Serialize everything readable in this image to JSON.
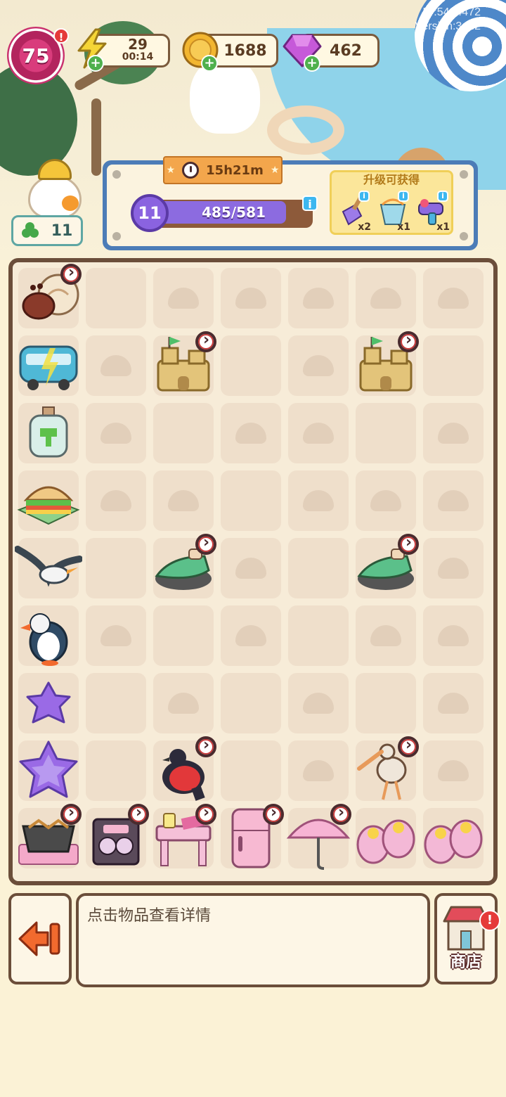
{
  "debug": {
    "id_text": "ID:5484472",
    "version_text": "Version:3.0.2"
  },
  "player": {
    "level": "75",
    "level_alert": "!"
  },
  "energy": {
    "value": "29",
    "timer": "00:14",
    "plus": "+"
  },
  "coins": {
    "value": "1688",
    "plus": "+"
  },
  "gems": {
    "value": "462",
    "plus": "+"
  },
  "workers": {
    "count": "11"
  },
  "level_panel": {
    "timer": "15h21m",
    "star_level": "11",
    "xp_text": "485/581",
    "xp_progress": 0.835,
    "reward_title": "升级可获得",
    "rewards": [
      {
        "icon": "shovel-icon",
        "qty": "x2"
      },
      {
        "icon": "sand-bucket-icon",
        "qty": "x1"
      },
      {
        "icon": "water-gun-icon",
        "qty": "x1"
      }
    ],
    "info": "i"
  },
  "board": {
    "rows": 9,
    "cols": 7,
    "items": [
      {
        "row": 0,
        "col": 0,
        "name": "hermit-crab-item",
        "timer": true
      },
      {
        "row": 1,
        "col": 0,
        "name": "beach-bus-item",
        "timer": false
      },
      {
        "row": 1,
        "col": 2,
        "name": "sandcastle-item",
        "timer": true
      },
      {
        "row": 1,
        "col": 5,
        "name": "sandcastle-item",
        "timer": true
      },
      {
        "row": 2,
        "col": 0,
        "name": "bottle-item",
        "timer": false
      },
      {
        "row": 3,
        "col": 0,
        "name": "sandwich-item",
        "timer": false
      },
      {
        "row": 4,
        "col": 0,
        "name": "seagull-item",
        "timer": false
      },
      {
        "row": 4,
        "col": 2,
        "name": "jet-ski-item",
        "timer": true
      },
      {
        "row": 4,
        "col": 5,
        "name": "jet-ski-item",
        "timer": true
      },
      {
        "row": 5,
        "col": 0,
        "name": "puffin-item",
        "timer": false
      },
      {
        "row": 6,
        "col": 0,
        "name": "purple-star-small-item",
        "timer": false
      },
      {
        "row": 7,
        "col": 0,
        "name": "purple-star-large-item",
        "timer": false
      },
      {
        "row": 7,
        "col": 2,
        "name": "red-bird-item",
        "timer": true
      },
      {
        "row": 7,
        "col": 5,
        "name": "stork-item",
        "timer": true
      },
      {
        "row": 8,
        "col": 0,
        "name": "grill-item",
        "timer": true
      },
      {
        "row": 8,
        "col": 1,
        "name": "boombox-item",
        "timer": true
      },
      {
        "row": 8,
        "col": 2,
        "name": "pink-table-item",
        "timer": true
      },
      {
        "row": 8,
        "col": 3,
        "name": "fridge-item",
        "timer": true
      },
      {
        "row": 8,
        "col": 4,
        "name": "pink-umbrella-item",
        "timer": true
      },
      {
        "row": 8,
        "col": 5,
        "name": "flower-slippers-item",
        "timer": false
      },
      {
        "row": 8,
        "col": 6,
        "name": "flower-slippers-item",
        "timer": false
      }
    ],
    "empty_plain": [
      [
        0,
        1
      ],
      [
        1,
        3
      ],
      [
        1,
        6
      ],
      [
        2,
        2
      ],
      [
        2,
        5
      ],
      [
        3,
        3
      ],
      [
        4,
        1
      ],
      [
        4,
        4
      ],
      [
        5,
        2
      ],
      [
        5,
        4
      ],
      [
        6,
        1
      ],
      [
        6,
        3
      ],
      [
        6,
        5
      ],
      [
        7,
        1
      ],
      [
        7,
        3
      ]
    ]
  },
  "info_box": {
    "text": "点击物品查看详情"
  },
  "shop": {
    "label": "商店",
    "alert": "!"
  }
}
